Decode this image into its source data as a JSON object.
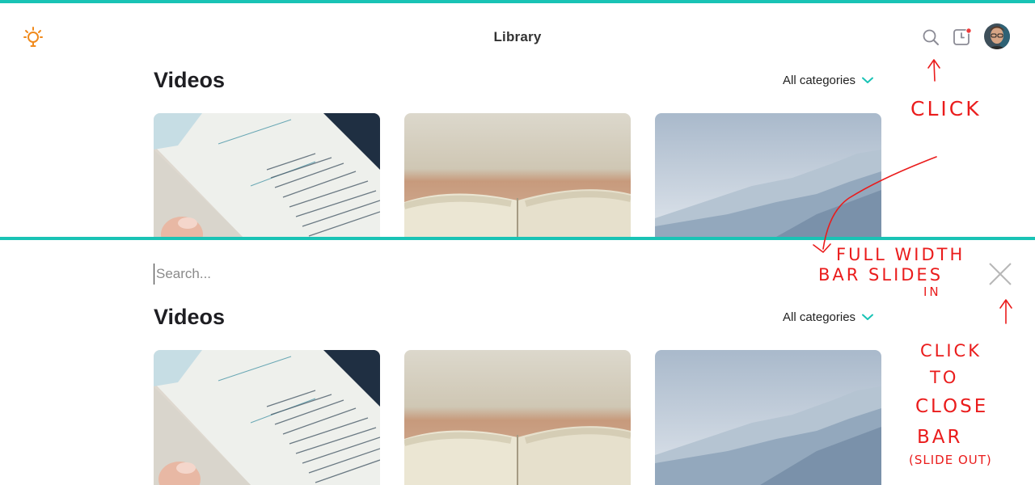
{
  "header": {
    "title": "Library",
    "icons": {
      "logo": "lightbulb-icon",
      "search": "search-icon",
      "notifications": "notification-icon",
      "avatar": "user-avatar"
    },
    "notification_dot_color": "#ef3b3b"
  },
  "top_section": {
    "heading": "Videos",
    "filter": {
      "selected": "All categories",
      "icon": "chevron-down-icon"
    },
    "thumbnails": [
      "book-page-photo",
      "open-book-photo",
      "mountain-haze-photo"
    ]
  },
  "search_bar": {
    "placeholder": "Search...",
    "value": "",
    "close_icon": "close-icon"
  },
  "bottom_section": {
    "heading": "Videos",
    "filter": {
      "selected": "All categories",
      "icon": "chevron-down-icon"
    },
    "thumbnails": [
      "book-page-photo",
      "open-book-photo",
      "mountain-haze-photo"
    ]
  },
  "annotations": {
    "click_note": "CLICK",
    "slide_note_line1": "FULL WIDTH",
    "slide_note_line2": "BAR SLIDES",
    "slide_note_line3": "IN",
    "close_note_line1": "CLICK",
    "close_note_line2": "TO",
    "close_note_line3": "CLOSE",
    "close_note_line4": "BAR",
    "close_note_line5": "(SLIDE OUT)"
  },
  "colors": {
    "accent": "#19c3b5",
    "logo": "#f08a1c",
    "annotation": "#ea1c1c",
    "text": "#1e1e22"
  }
}
